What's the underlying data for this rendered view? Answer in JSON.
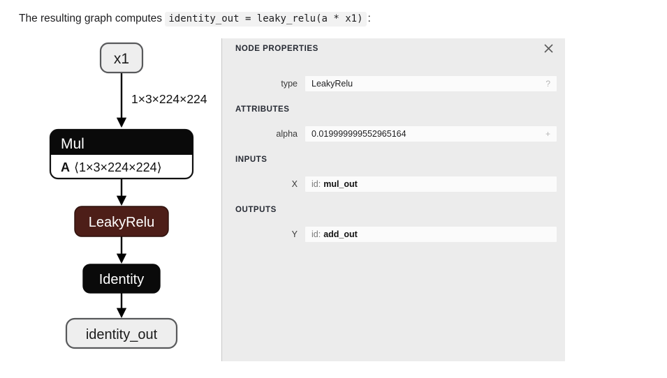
{
  "caption": {
    "text_before": "The resulting graph computes",
    "code": "identity_out = leaky_relu(a * x1)",
    "text_after": ":"
  },
  "graph": {
    "nodes": [
      {
        "id": "x1",
        "kind": "io",
        "label": "x1"
      },
      {
        "id": "mul",
        "kind": "op-block",
        "label": "Mul",
        "attr_key": "A",
        "attr_value": "⟨1×3×224×224⟩"
      },
      {
        "id": "leakyrelu",
        "kind": "op",
        "label": "LeakyRelu"
      },
      {
        "id": "identity",
        "kind": "op",
        "label": "Identity"
      },
      {
        "id": "identity_out",
        "kind": "io",
        "label": "identity_out"
      }
    ],
    "edges": [
      {
        "from": "x1",
        "to": "mul",
        "label": "1×3×224×224"
      },
      {
        "from": "mul",
        "to": "leakyrelu",
        "label": ""
      },
      {
        "from": "leakyrelu",
        "to": "identity",
        "label": ""
      },
      {
        "from": "identity",
        "to": "identity_out",
        "label": ""
      }
    ],
    "colors": {
      "io_fill": "#eeeeee",
      "io_stroke": "#58595b",
      "op_fill": "#0a0a0a",
      "op_text": "#ffffff",
      "activation_fill": "#4d1e18",
      "body_fill": "#ffffff",
      "edge": "#000000"
    }
  },
  "panel": {
    "title": "NODE PROPERTIES",
    "close_icon": "close-icon",
    "rows_top": [
      {
        "label": "type",
        "value": "LeakyRelu",
        "affordance": "?"
      }
    ],
    "sections": [
      {
        "title": "ATTRIBUTES",
        "rows": [
          {
            "label": "alpha",
            "value": "0.019999999552965164",
            "affordance": "+"
          }
        ]
      },
      {
        "title": "INPUTS",
        "rows": [
          {
            "label": "X",
            "id_prefix": "id:",
            "id_name": "mul_out"
          }
        ]
      },
      {
        "title": "OUTPUTS",
        "rows": [
          {
            "label": "Y",
            "id_prefix": "id:",
            "id_name": "add_out"
          }
        ]
      }
    ],
    "colors": {
      "background": "#ececec",
      "field": "#fbfbfb",
      "title": "#262a33"
    }
  }
}
